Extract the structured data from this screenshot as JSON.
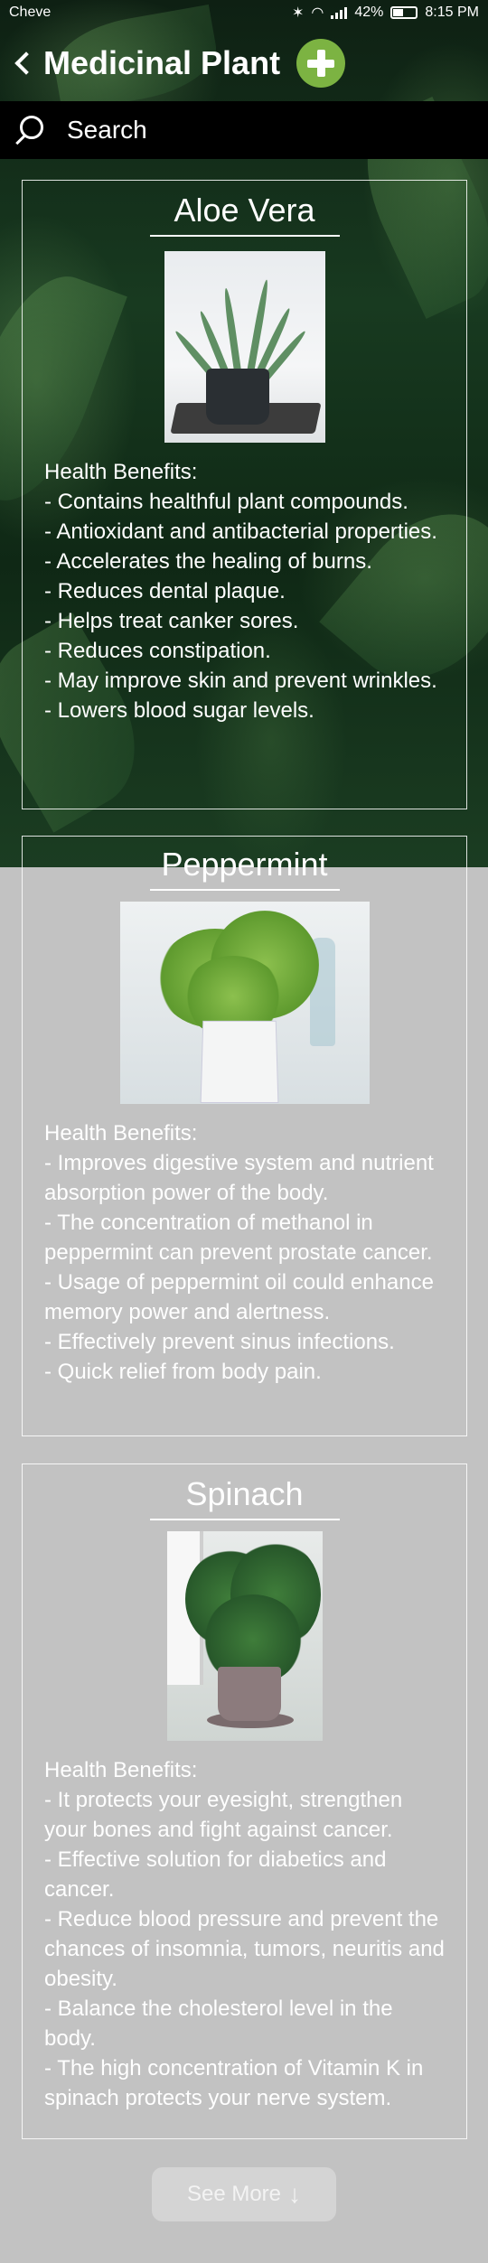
{
  "status_bar": {
    "carrier": "Cheve",
    "battery": "42%",
    "time": "8:15 PM"
  },
  "app_bar": {
    "title": "Medicinal Plant"
  },
  "search": {
    "placeholder": "Search"
  },
  "plants": [
    {
      "name": "Aloe Vera",
      "benefits_heading": "Health Benefits:",
      "benefits": [
        "- Contains healthful plant compounds.",
        "- Antioxidant and antibacterial properties.",
        "- Accelerates the healing of burns.",
        "- Reduces dental plaque.",
        "- Helps treat canker sores.",
        "- Reduces constipation.",
        "- May improve skin and prevent wrinkles.",
        "- Lowers blood sugar levels."
      ]
    },
    {
      "name": "Peppermint",
      "benefits_heading": "Health Benefits:",
      "benefits": [
        "- Improves digestive system and nutrient absorption power of the body.",
        "- The concentration of methanol in peppermint can prevent prostate cancer.",
        "- Usage of peppermint oil could enhance memory power and alertness.",
        "- Effectively prevent sinus infections.",
        "- Quick relief from body pain."
      ]
    },
    {
      "name": "Spinach",
      "benefits_heading": "Health Benefits:",
      "benefits": [
        "- It protects your eyesight, strengthen your bones and fight against cancer.",
        "- Effective solution for diabetics and cancer.",
        "- Reduce blood pressure and prevent the chances of insomnia, tumors, neuritis and obesity.",
        "- Balance the cholesterol level in the body.",
        "- The high concentration of Vitamin K in spinach protects your nerve system."
      ]
    }
  ],
  "see_more": {
    "label": "See More",
    "arrow": "↓"
  }
}
